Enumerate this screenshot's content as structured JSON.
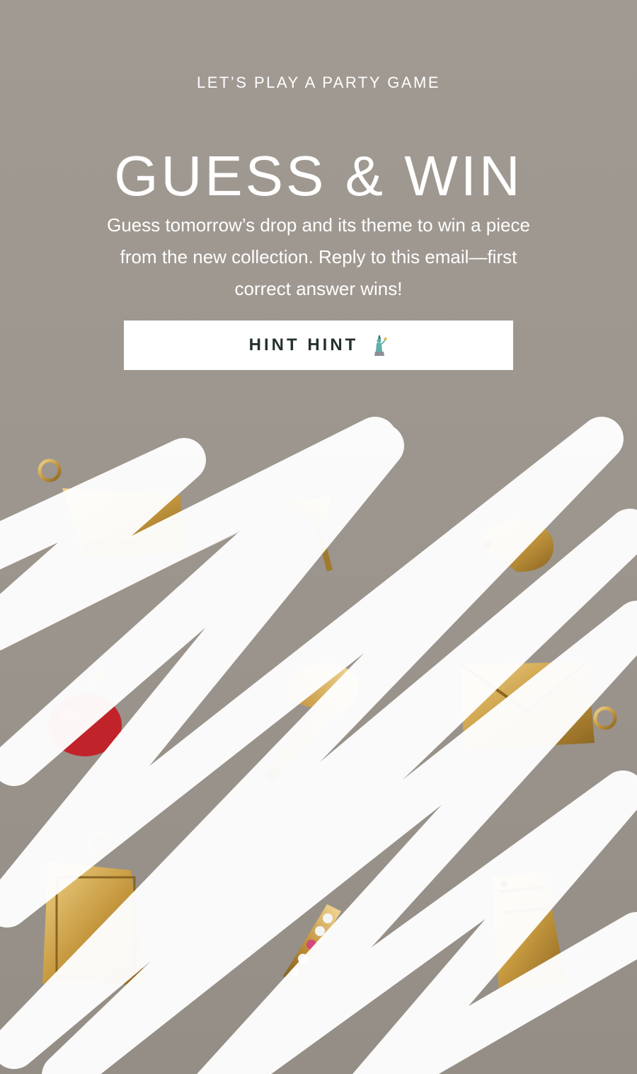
{
  "hero": {
    "eyebrow": "LET’S PLAY A PARTY GAME",
    "headline": "GUESS & WIN",
    "body": "Guess tomorrow’s drop and its theme to win a piece from the new collection. Reply to this email—first correct answer wins!"
  },
  "cta": {
    "label": "HINT HINT",
    "icon": "statue-of-liberty-icon"
  },
  "colors": {
    "background": "#9e9890",
    "button_bg": "#ffffff",
    "button_text": "#24312e",
    "text": "#ffffff",
    "gold": "#c59a3d"
  }
}
